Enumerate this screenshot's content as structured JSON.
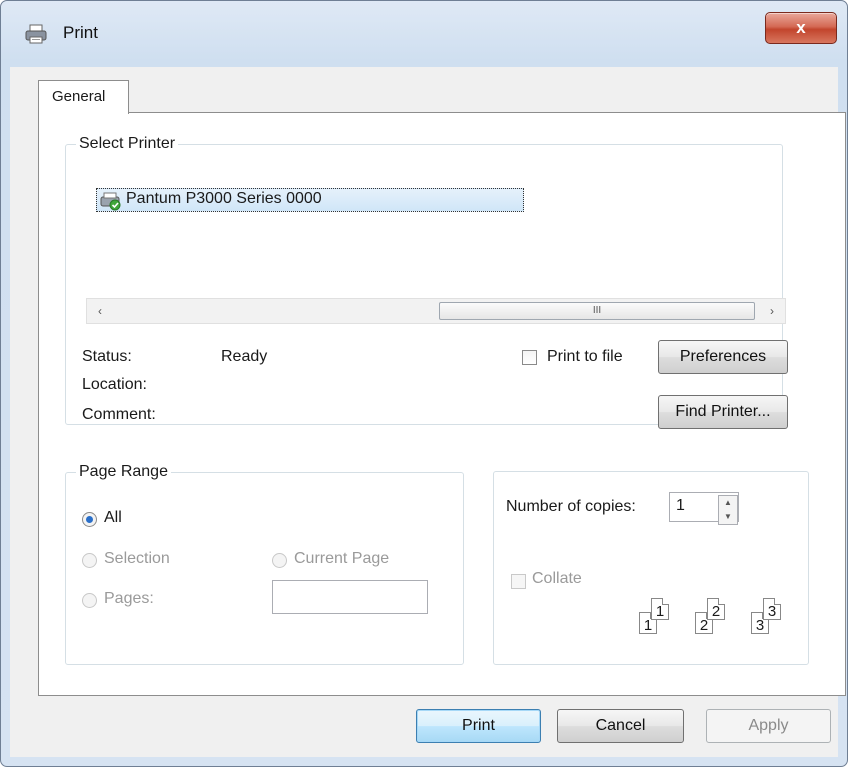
{
  "window": {
    "title": "Print",
    "close_glyph": "x"
  },
  "tabs": [
    {
      "label": "General"
    }
  ],
  "select_printer": {
    "legend": "Select Printer",
    "printers": [
      {
        "name": "Pantum P3000 Series 0000",
        "icon": "printer-default-icon"
      }
    ],
    "scrollbar": {
      "left_arrow": "‹",
      "right_arrow": "›",
      "grip": "III"
    }
  },
  "printer_info": {
    "status_label": "Status:",
    "status_value": "Ready",
    "location_label": "Location:",
    "location_value": "",
    "comment_label": "Comment:",
    "comment_value": ""
  },
  "print_to_file": {
    "label": "Print to file",
    "checked": false
  },
  "buttons": {
    "preferences": "Preferences",
    "find_printer": "Find Printer...",
    "print": "Print",
    "cancel": "Cancel",
    "apply": "Apply"
  },
  "page_range": {
    "legend": "Page Range",
    "all_label": "All",
    "selection_label": "Selection",
    "current_page_label": "Current Page",
    "pages_label": "Pages:",
    "pages_value": "",
    "selected": "All"
  },
  "copies": {
    "label": "Number of copies:",
    "value": "1",
    "collate_label": "Collate",
    "collate_checked": false,
    "collate_pages": [
      "1",
      "1",
      "2",
      "2",
      "3",
      "3"
    ]
  }
}
